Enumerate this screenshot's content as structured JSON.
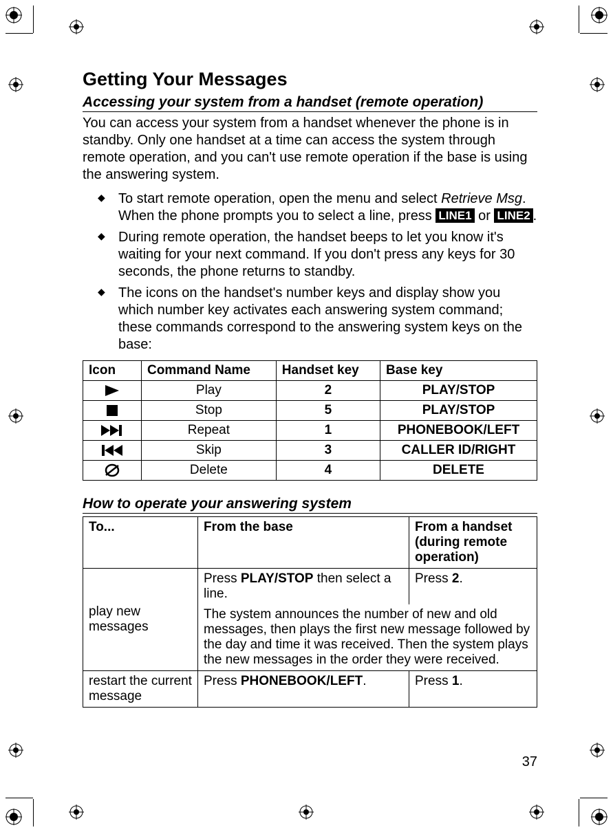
{
  "title": "Getting Your Messages",
  "section1_title": "Accessing your system from a handset (remote operation)",
  "intro": "You can access your system from a handset whenever the phone is in standby. Only one handset at a time can access the system through remote operation, and you can't use remote operation if the base is using the answering system.",
  "bullets": {
    "b1_pre": "To start remote operation, open the menu and select ",
    "b1_em": "Retrieve Msg",
    "b1_mid": ". When the phone prompts you to select a line, press ",
    "b1_line1": "LINE1",
    "b1_or": " or ",
    "b1_line2": "LINE2",
    "b1_end": ".",
    "b2": "During remote operation, the handset beeps to let you know it's waiting for your next command. If you don't press any keys for 30 seconds, the phone returns to standby.",
    "b3": "The icons on the handset's number keys and display show you which number key activates each answering system command; these commands correspond to the answering system keys on the base:"
  },
  "cmd_table": {
    "headers": [
      "Icon",
      "Command Name",
      "Handset key",
      "Base key"
    ],
    "rows": [
      {
        "icon": "play",
        "name": "Play",
        "hkey": "2",
        "bkey": "PLAY/STOP"
      },
      {
        "icon": "stop",
        "name": "Stop",
        "hkey": "5",
        "bkey": "PLAY/STOP"
      },
      {
        "icon": "next",
        "name": "Repeat",
        "hkey": "1",
        "bkey": "PHONEBOOK/LEFT"
      },
      {
        "icon": "prev",
        "name": "Skip",
        "hkey": "3",
        "bkey": "CALLER ID/RIGHT"
      },
      {
        "icon": "delete",
        "name": "Delete",
        "hkey": "4",
        "bkey": "DELETE"
      }
    ]
  },
  "section2_title": "How to operate your answering system",
  "op_table": {
    "headers": [
      "To...",
      "From the base",
      "From a handset (during remote operation)"
    ],
    "row1": {
      "to": "play new messages",
      "base_pre": "Press ",
      "base_key": "PLAY/STOP",
      "base_post": " then select a line.",
      "hand_pre": "Press ",
      "hand_key": "2",
      "hand_post": ".",
      "shared": "The system announces the number of new and old messages, then plays the first new message followed by the day and time it was received. Then the system plays the new messages in the order they were received."
    },
    "row2": {
      "to": "restart the current message",
      "base_pre": "Press ",
      "base_key": "PHONEBOOK/LEFT",
      "base_post": ".",
      "hand_pre": "Press ",
      "hand_key": "1",
      "hand_post": "."
    }
  },
  "page_number": "37"
}
